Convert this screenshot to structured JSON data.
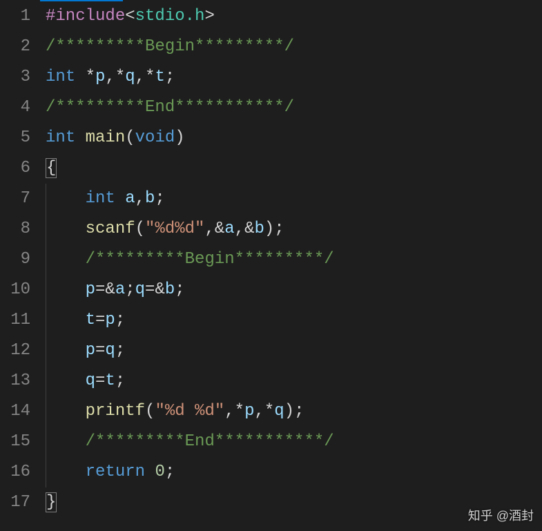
{
  "watermark": "知乎 @酒封",
  "lines": [
    {
      "num": "1",
      "indent": 0,
      "tokens": [
        {
          "cls": "tok-macro",
          "t": "#include"
        },
        {
          "cls": "tok-punct",
          "t": "<"
        },
        {
          "cls": "tok-header",
          "t": "stdio.h"
        },
        {
          "cls": "tok-punct",
          "t": ">"
        }
      ]
    },
    {
      "num": "2",
      "indent": 0,
      "tokens": [
        {
          "cls": "tok-comment",
          "t": "/*********Begin*********/"
        }
      ]
    },
    {
      "num": "3",
      "indent": 0,
      "tokens": [
        {
          "cls": "tok-type",
          "t": "int"
        },
        {
          "cls": "tok-punct",
          "t": " "
        },
        {
          "cls": "tok-op",
          "t": "*"
        },
        {
          "cls": "tok-var",
          "t": "p"
        },
        {
          "cls": "tok-punct",
          "t": ","
        },
        {
          "cls": "tok-op",
          "t": "*"
        },
        {
          "cls": "tok-var",
          "t": "q"
        },
        {
          "cls": "tok-punct",
          "t": ","
        },
        {
          "cls": "tok-op",
          "t": "*"
        },
        {
          "cls": "tok-var",
          "t": "t"
        },
        {
          "cls": "tok-punct",
          "t": ";"
        }
      ]
    },
    {
      "num": "4",
      "indent": 0,
      "tokens": [
        {
          "cls": "tok-comment",
          "t": "/*********End***********/"
        }
      ]
    },
    {
      "num": "5",
      "indent": 0,
      "tokens": [
        {
          "cls": "tok-type",
          "t": "int"
        },
        {
          "cls": "tok-punct",
          "t": " "
        },
        {
          "cls": "tok-func",
          "t": "main"
        },
        {
          "cls": "tok-punct",
          "t": "("
        },
        {
          "cls": "tok-type",
          "t": "void"
        },
        {
          "cls": "tok-punct",
          "t": ")"
        }
      ]
    },
    {
      "num": "6",
      "indent": 0,
      "tokens": [
        {
          "cls": "tok-punct cursor-box",
          "t": "{"
        }
      ]
    },
    {
      "num": "7",
      "indent": 1,
      "tokens": [
        {
          "cls": "tok-type",
          "t": "int"
        },
        {
          "cls": "tok-punct",
          "t": " "
        },
        {
          "cls": "tok-var",
          "t": "a"
        },
        {
          "cls": "tok-punct",
          "t": ","
        },
        {
          "cls": "tok-var",
          "t": "b"
        },
        {
          "cls": "tok-punct",
          "t": ";"
        }
      ]
    },
    {
      "num": "8",
      "indent": 1,
      "tokens": [
        {
          "cls": "tok-func",
          "t": "scanf"
        },
        {
          "cls": "tok-punct",
          "t": "("
        },
        {
          "cls": "tok-string",
          "t": "\"%d%d\""
        },
        {
          "cls": "tok-punct",
          "t": ","
        },
        {
          "cls": "tok-op",
          "t": "&"
        },
        {
          "cls": "tok-var",
          "t": "a"
        },
        {
          "cls": "tok-punct",
          "t": ","
        },
        {
          "cls": "tok-op",
          "t": "&"
        },
        {
          "cls": "tok-var",
          "t": "b"
        },
        {
          "cls": "tok-punct",
          "t": ");"
        }
      ]
    },
    {
      "num": "9",
      "indent": 1,
      "tokens": [
        {
          "cls": "tok-comment",
          "t": "/*********Begin*********/"
        }
      ]
    },
    {
      "num": "10",
      "indent": 1,
      "tokens": [
        {
          "cls": "tok-var",
          "t": "p"
        },
        {
          "cls": "tok-op",
          "t": "="
        },
        {
          "cls": "tok-op",
          "t": "&"
        },
        {
          "cls": "tok-var",
          "t": "a"
        },
        {
          "cls": "tok-punct",
          "t": ";"
        },
        {
          "cls": "tok-var",
          "t": "q"
        },
        {
          "cls": "tok-op",
          "t": "="
        },
        {
          "cls": "tok-op",
          "t": "&"
        },
        {
          "cls": "tok-var",
          "t": "b"
        },
        {
          "cls": "tok-punct",
          "t": ";"
        }
      ]
    },
    {
      "num": "11",
      "indent": 1,
      "tokens": [
        {
          "cls": "tok-var",
          "t": "t"
        },
        {
          "cls": "tok-op",
          "t": "="
        },
        {
          "cls": "tok-var",
          "t": "p"
        },
        {
          "cls": "tok-punct",
          "t": ";"
        }
      ]
    },
    {
      "num": "12",
      "indent": 1,
      "tokens": [
        {
          "cls": "tok-var",
          "t": "p"
        },
        {
          "cls": "tok-op",
          "t": "="
        },
        {
          "cls": "tok-var",
          "t": "q"
        },
        {
          "cls": "tok-punct",
          "t": ";"
        }
      ]
    },
    {
      "num": "13",
      "indent": 1,
      "tokens": [
        {
          "cls": "tok-var",
          "t": "q"
        },
        {
          "cls": "tok-op",
          "t": "="
        },
        {
          "cls": "tok-var",
          "t": "t"
        },
        {
          "cls": "tok-punct",
          "t": ";"
        }
      ]
    },
    {
      "num": "14",
      "indent": 1,
      "tokens": [
        {
          "cls": "tok-func",
          "t": "printf"
        },
        {
          "cls": "tok-punct",
          "t": "("
        },
        {
          "cls": "tok-string",
          "t": "\"%d %d\""
        },
        {
          "cls": "tok-punct",
          "t": ","
        },
        {
          "cls": "tok-op",
          "t": "*"
        },
        {
          "cls": "tok-var",
          "t": "p"
        },
        {
          "cls": "tok-punct",
          "t": ","
        },
        {
          "cls": "tok-op",
          "t": "*"
        },
        {
          "cls": "tok-var",
          "t": "q"
        },
        {
          "cls": "tok-punct",
          "t": ");"
        }
      ]
    },
    {
      "num": "15",
      "indent": 1,
      "tokens": [
        {
          "cls": "tok-comment",
          "t": "/*********End***********/"
        }
      ]
    },
    {
      "num": "16",
      "indent": 1,
      "tokens": [
        {
          "cls": "tok-keyword",
          "t": "return"
        },
        {
          "cls": "tok-punct",
          "t": " "
        },
        {
          "cls": "tok-number",
          "t": "0"
        },
        {
          "cls": "tok-punct",
          "t": ";"
        }
      ]
    },
    {
      "num": "17",
      "indent": 0,
      "tokens": [
        {
          "cls": "tok-punct cursor-box",
          "t": "}"
        }
      ]
    }
  ]
}
